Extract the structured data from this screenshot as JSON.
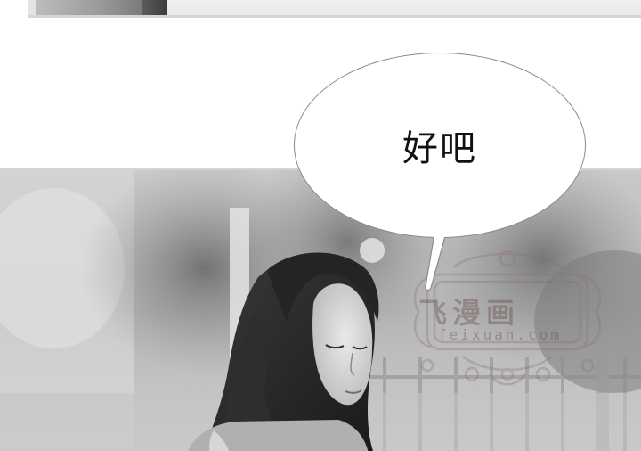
{
  "speech_bubble": {
    "text": "好吧"
  },
  "watermark": {
    "title": "飞漫画",
    "site": "feixuan.com"
  },
  "icons": {
    "watermark_emblem": "ornamental-frame-icon"
  }
}
